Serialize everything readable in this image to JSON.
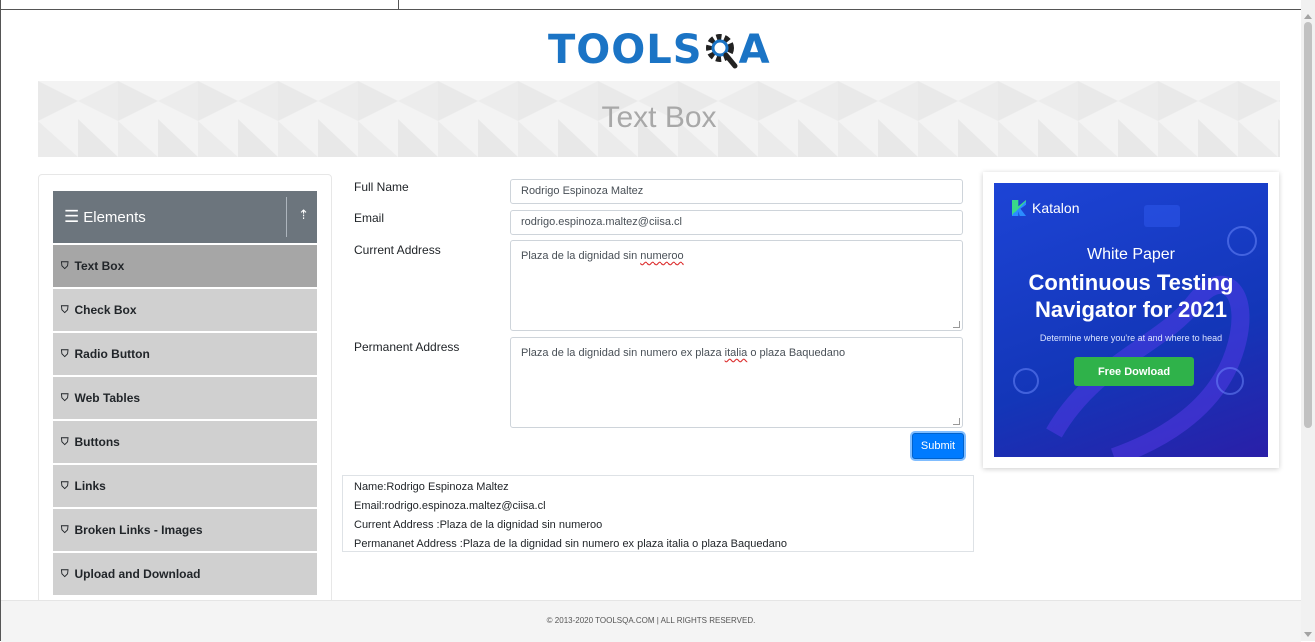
{
  "logo": {
    "text": "TOOLS",
    "text_tail": "A"
  },
  "banner": {
    "title": "Text Box"
  },
  "sidebar": {
    "group": "Elements",
    "items": [
      {
        "label": "Text Box",
        "active": true
      },
      {
        "label": "Check Box"
      },
      {
        "label": "Radio Button"
      },
      {
        "label": "Web Tables"
      },
      {
        "label": "Buttons"
      },
      {
        "label": "Links"
      },
      {
        "label": "Broken Links - Images"
      },
      {
        "label": "Upload and Download"
      }
    ]
  },
  "form": {
    "full_name_label": "Full Name",
    "full_name_value": "Rodrigo Espinoza Maltez",
    "email_label": "Email",
    "email_value": "rodrigo.espinoza.maltez@ciisa.cl",
    "current_address_label": "Current Address",
    "current_address_value_a": "Plaza de la dignidad sin ",
    "current_address_value_b": "numeroo",
    "permanent_address_label": "Permanent Address",
    "permanent_address_value_a": "Plaza de la dignidad sin numero ex plaza ",
    "permanent_address_value_b": "italia",
    "permanent_address_value_c": " o plaza Baquedano",
    "submit_label": "Submit"
  },
  "output": {
    "name": "Name:Rodrigo Espinoza Maltez",
    "email": "Email:rodrigo.espinoza.maltez@ciisa.cl",
    "current": "Current Address :Plaza de la dignidad sin numeroo",
    "permanent": "Permananet Address :Plaza de la dignidad sin numero ex plaza italia o plaza Baquedano"
  },
  "ad": {
    "brand": "Katalon",
    "kicker": "White Paper",
    "headline_1": "Continuous Testing",
    "headline_2": "Navigator for 2021",
    "sub": "Determine where you're at and where to head",
    "cta": "Free Dowload"
  },
  "footer": {
    "text": "© 2013-2020 TOOLSQA.COM | ALL RIGHTS RESERVED."
  },
  "colors": {
    "primary": "#007bff",
    "logo": "#1b74c5",
    "sidebar_header": "#6c757d",
    "ad_bg": "#1d44d6",
    "cta": "#2fb24a"
  }
}
